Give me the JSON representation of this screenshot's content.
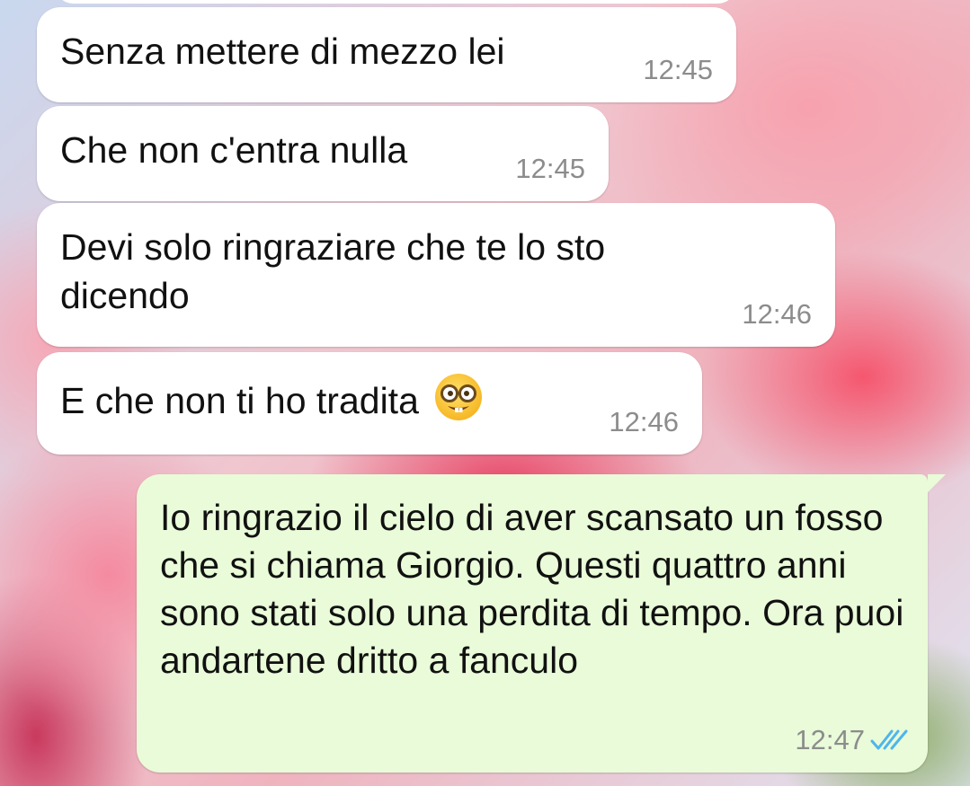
{
  "chat": {
    "messages": [
      {
        "text": "Senza mettere di mezzo lei",
        "time": "12:45",
        "direction": "incoming"
      },
      {
        "text": "Che non c'entra nulla",
        "time": "12:45",
        "direction": "incoming"
      },
      {
        "text": "Devi solo ringraziare che te lo sto dicendo",
        "time": "12:46",
        "direction": "incoming"
      },
      {
        "text": "E che non ti ho tradita",
        "emoji": "nerd-face-emoji",
        "time": "12:46",
        "direction": "incoming"
      },
      {
        "text": "Io ringrazio il cielo di aver scansato un fosso che si chiama Giorgio. Questi quattro anni sono stati solo una perdita di tempo. Ora puoi andartene dritto a fanculo",
        "time": "12:47",
        "direction": "outgoing",
        "status": "read"
      }
    ]
  },
  "colors": {
    "incoming_bubble": "#ffffff",
    "outgoing_bubble": "#e9fbd8",
    "timestamp": "#8c8c8c",
    "read_ticks": "#4fb5ec"
  },
  "icons": {
    "read_status": "double-check-icon"
  }
}
